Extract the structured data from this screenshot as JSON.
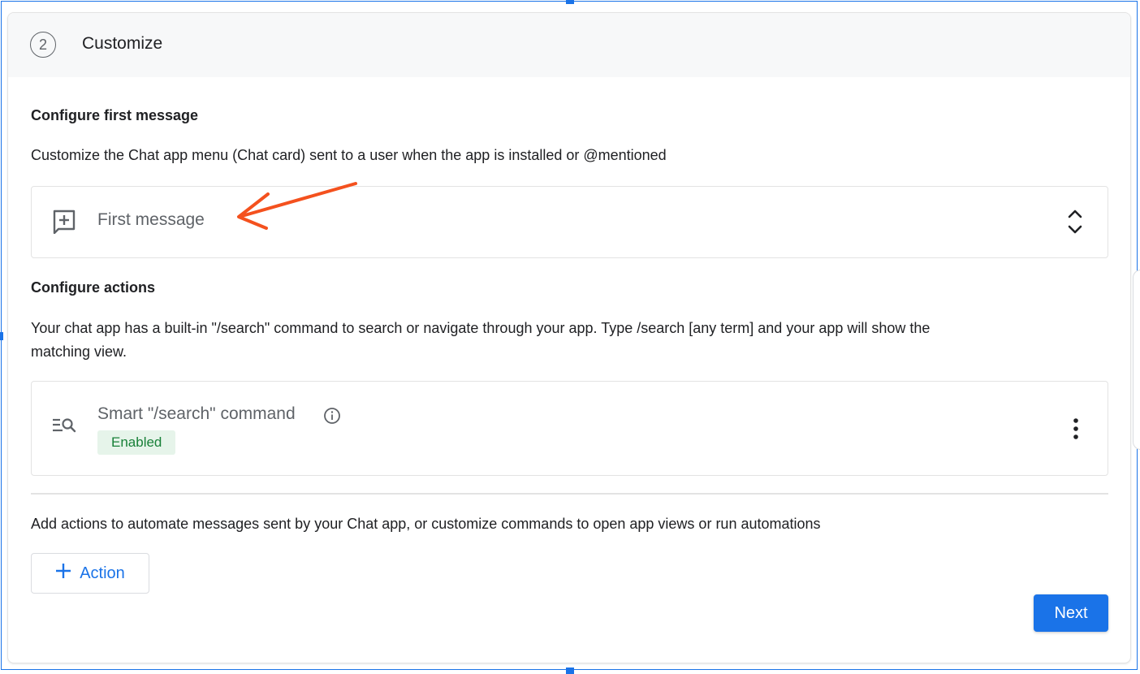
{
  "step": {
    "number": "2",
    "title": "Customize"
  },
  "first_message_section": {
    "title": "Configure first message",
    "description": "Customize the Chat app menu (Chat card) sent to a user when the app is installed or @mentioned",
    "panel_label": "First message",
    "panel_icon": "add-comment-icon",
    "expand_icon": "unfold-more-icon"
  },
  "actions_section": {
    "title": "Configure actions",
    "description_line1": "Your chat app has a built-in \"/search\" command to search or navigate through your app. Type /search [any term] and your app will show the",
    "description_line2": "matching view.",
    "search_command": {
      "icon": "manage-search-icon",
      "label": "Smart \"/search\" command",
      "info_icon": "info-icon",
      "status": "Enabled",
      "menu_icon": "more-vert-icon"
    },
    "add_actions_text": "Add actions to automate messages sent by your Chat app, or customize commands to open app views or run automations",
    "add_action_button": "Action"
  },
  "footer": {
    "next_button": "Next"
  },
  "colors": {
    "accent": "#1a73e8",
    "status_green": "#188038",
    "status_bg": "#e6f4ea",
    "annotation_arrow": "#f4511e"
  }
}
